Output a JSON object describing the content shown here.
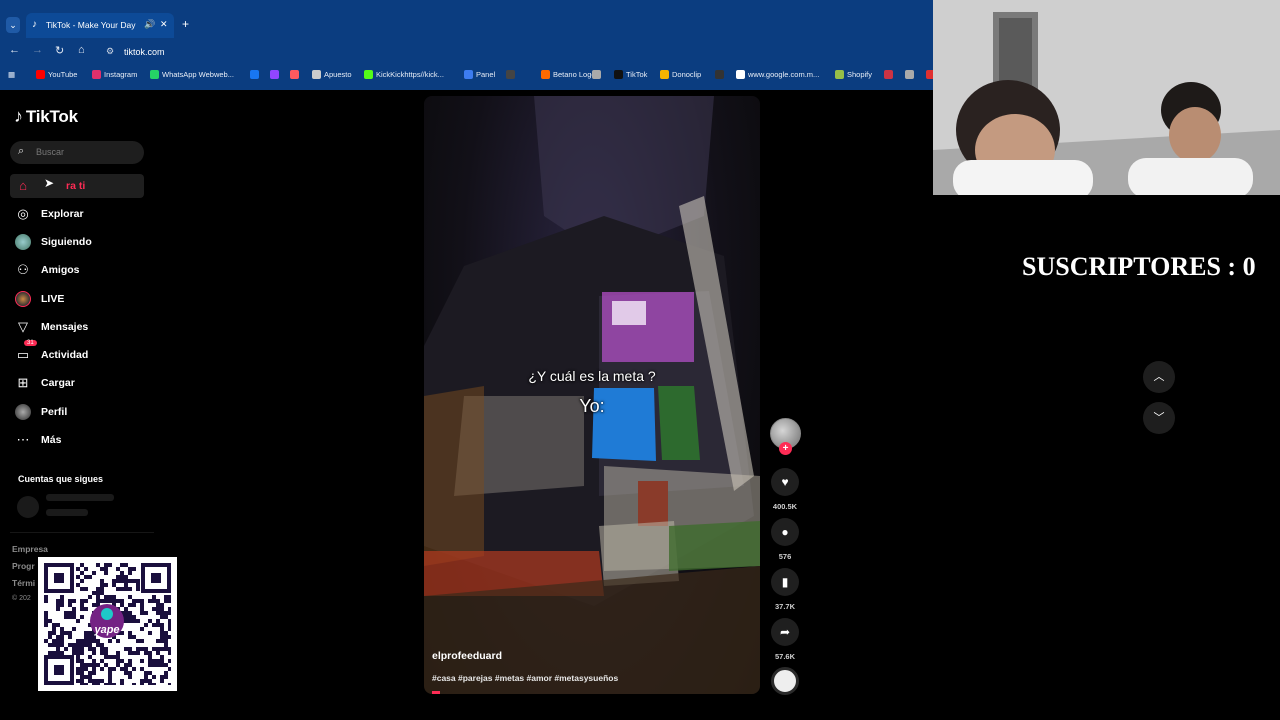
{
  "browser": {
    "tab": {
      "title": "TikTok - Make Your Day"
    },
    "address": {
      "url": "tiktok.com"
    },
    "bookmarks": [
      {
        "label": "YouTube",
        "color": "#ff0000"
      },
      {
        "label": "Instagram",
        "color": "#e1306c"
      },
      {
        "label": "WhatsApp Webweb...",
        "color": "#25d366"
      },
      {
        "label": "",
        "color": "#1877f2"
      },
      {
        "label": "",
        "color": "#9146ff"
      },
      {
        "label": "",
        "color": "#ff5a5f"
      },
      {
        "label": "Apuesto",
        "color": "#cccccc"
      },
      {
        "label": "KickKickhttps//kick...",
        "color": "#53fc18"
      },
      {
        "label": "Panel",
        "color": "#3d7cf0"
      },
      {
        "label": "",
        "color": "#444444"
      },
      {
        "label": "Betano Logo",
        "color": "#ff6a00"
      },
      {
        "label": "",
        "color": "#aaaaaa"
      },
      {
        "label": "TikTok",
        "color": "#111111"
      },
      {
        "label": "Donoclip",
        "color": "#f5b400"
      },
      {
        "label": "",
        "color": "#333333"
      },
      {
        "label": "www.google.com.m...",
        "color": "#ffffff"
      },
      {
        "label": "Shopify",
        "color": "#96bf48"
      },
      {
        "label": "",
        "color": "#cc3344"
      },
      {
        "label": "",
        "color": "#aaaaaa"
      },
      {
        "label": "",
        "color": "#e03030"
      }
    ]
  },
  "tiktok": {
    "logo": "TikTok",
    "search": {
      "placeholder": "Buscar"
    },
    "nav": {
      "for_you": "ra ti",
      "explore": "Explorar",
      "following": "Siguiendo",
      "friends": "Amigos",
      "live": "LIVE",
      "messages": "Mensajes",
      "activity": "Actividad",
      "activity_badge": "31",
      "upload": "Cargar",
      "profile": "Perfil",
      "more": "Más"
    },
    "following_title": "Cuentas que sigues",
    "footer": {
      "company": "Empresa",
      "programs": "Progr",
      "terms": "Térmi",
      "copyright": "© 202"
    }
  },
  "video": {
    "caption_question": "¿Y cuál es la meta ?",
    "caption_answer": "Yo:",
    "author": "elprofeeduard",
    "hashtags": "#casa #parejas #metas #amor #metasysueños",
    "likes": "400.5K",
    "comments": "576",
    "saves": "37.7K",
    "shares": "57.6K"
  },
  "overlay": {
    "subscribers": "SUSCRIPTORES : 0",
    "qr_brand": "yape"
  }
}
